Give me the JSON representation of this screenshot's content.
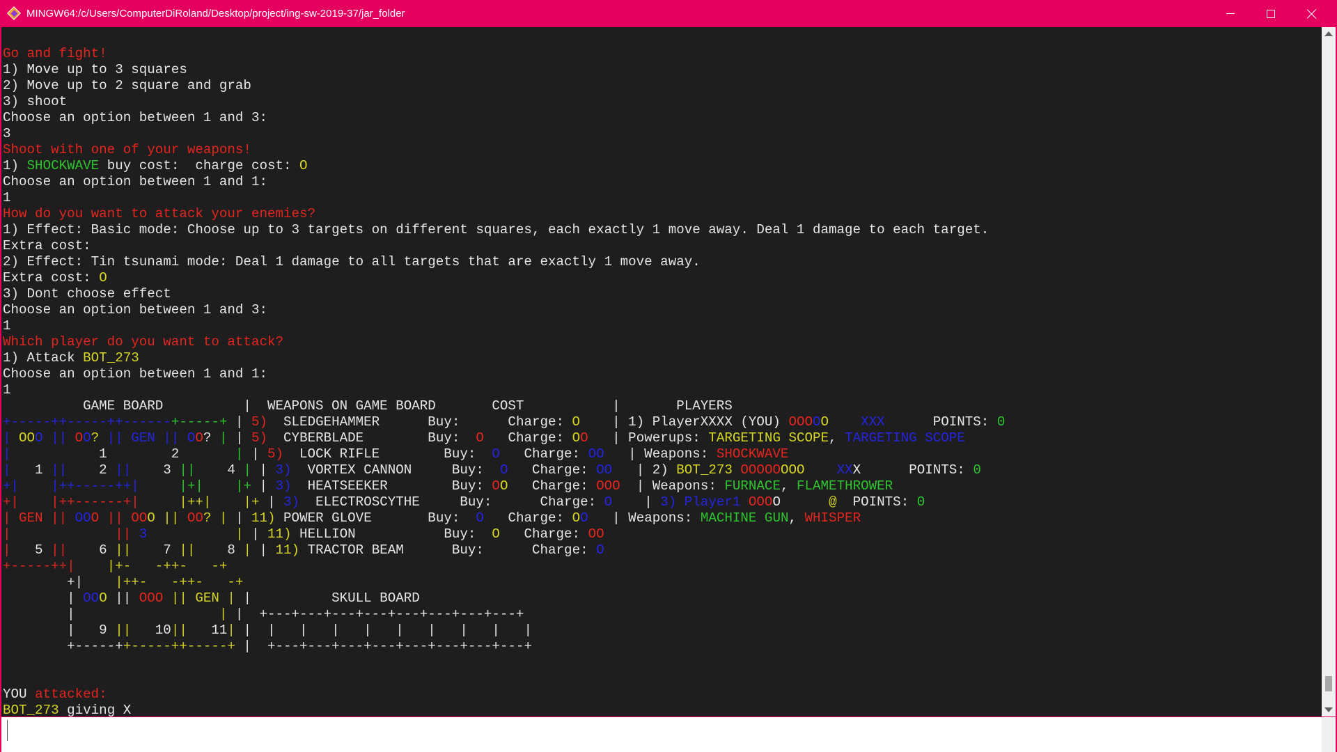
{
  "window": {
    "title": "MINGW64:/c/Users/ComputerDiRoland/Desktop/project/ing-sw-2019-37/jar_folder"
  },
  "icons": [
    "app-icon",
    "minimize-icon",
    "maximize-icon",
    "close-icon",
    "scroll-up-icon",
    "scroll-down-icon"
  ],
  "colors": {
    "titlebar": "#e5005f",
    "terminal_bg": "#1e1e1e",
    "text": "#e6e6e6",
    "red": "#e5251f",
    "green": "#2ec52e",
    "yellow": "#d6d623",
    "blue": "#2424e2"
  },
  "terminal": {
    "lines": [
      [
        {
          "t": "Go and fight!",
          "c": "r"
        }
      ],
      [
        {
          "t": "1) Move up to 3 squares"
        }
      ],
      [
        {
          "t": "2) Move up to 2 square and grab"
        }
      ],
      [
        {
          "t": "3) shoot"
        }
      ],
      [
        {
          "t": "Choose an option between 1 and 3:"
        }
      ],
      [
        {
          "t": "3"
        }
      ],
      [
        {
          "t": "Shoot with one of your weapons!",
          "c": "r"
        }
      ],
      [
        {
          "t": "1) "
        },
        {
          "t": "SHOCKWAVE",
          "c": "g"
        },
        {
          "t": " buy cost:  charge cost: "
        },
        {
          "t": "O",
          "c": "y"
        }
      ],
      [
        {
          "t": "Choose an option between 1 and 1:"
        }
      ],
      [
        {
          "t": "1"
        }
      ],
      [
        {
          "t": "How do you want to attack your enemies?",
          "c": "r"
        }
      ],
      [
        {
          "t": "1) Effect: Basic mode: Choose up to 3 targets on different squares, each exactly 1 move away. Deal 1 damage to each target."
        }
      ],
      [
        {
          "t": "Extra cost:"
        }
      ],
      [
        {
          "t": "2) Effect: Tin tsunami mode: Deal 1 damage to all targets that are exactly 1 move away."
        }
      ],
      [
        {
          "t": "Extra cost: "
        },
        {
          "t": "O",
          "c": "y"
        }
      ],
      [
        {
          "t": "3) Dont choose effect"
        }
      ],
      [
        {
          "t": "Choose an option between 1 and 3:"
        }
      ],
      [
        {
          "t": "1"
        }
      ],
      [
        {
          "t": "Which player do you want to attack?",
          "c": "r"
        }
      ],
      [
        {
          "t": "1) Attack "
        },
        {
          "t": "BOT_273",
          "c": "y"
        }
      ],
      [
        {
          "t": "Choose an option between 1 and 1:"
        }
      ],
      [
        {
          "t": "1"
        }
      ],
      [
        {
          "t": "          GAME BOARD          |  WEAPONS ON GAME BOARD       COST           |       PLAYERS"
        }
      ],
      [
        {
          "t": "+-----++-----++------",
          "c": "b"
        },
        {
          "t": "+-----+",
          "c": "g"
        },
        {
          "t": " | "
        },
        {
          "t": "5)",
          "c": "r"
        },
        {
          "t": "  SLEDGEHAMMER      Buy:      Charge: "
        },
        {
          "t": "O",
          "c": "y"
        },
        {
          "t": "    | 1) PlayerXXXX (YOU) "
        },
        {
          "t": "OOO",
          "c": "r"
        },
        {
          "t": "O",
          "c": "b"
        },
        {
          "t": "O",
          "c": "y"
        },
        {
          "t": "    "
        },
        {
          "t": "XXX",
          "c": "b"
        },
        {
          "t": "      POINTS: "
        },
        {
          "t": "0",
          "c": "g"
        }
      ],
      [
        {
          "t": "|",
          "c": "b"
        },
        {
          "t": " OO",
          "c": "y"
        },
        {
          "t": "O",
          "c": "b"
        },
        {
          "t": " || ",
          "c": "b"
        },
        {
          "t": "O",
          "c": "r"
        },
        {
          "t": "O",
          "c": "b"
        },
        {
          "t": "?",
          "c": "y"
        },
        {
          "t": " || GEN || ",
          "c": "b"
        },
        {
          "t": "O",
          "c": "b"
        },
        {
          "t": "O",
          "c": "r"
        },
        {
          "t": "?"
        },
        {
          "t": " |",
          "c": "g"
        },
        {
          "t": " | "
        },
        {
          "t": "5)",
          "c": "r"
        },
        {
          "t": "  CYBERBLADE        Buy:  "
        },
        {
          "t": "O",
          "c": "r"
        },
        {
          "t": "   Charge: "
        },
        {
          "t": "O",
          "c": "y"
        },
        {
          "t": "O",
          "c": "r"
        },
        {
          "t": "   | Powerups: "
        },
        {
          "t": "TARGETING SCOPE",
          "c": "y"
        },
        {
          "t": ", "
        },
        {
          "t": "TARGETING SCOPE",
          "c": "b"
        }
      ],
      [
        {
          "t": "|",
          "c": "b"
        },
        {
          "t": "           1        2       "
        },
        {
          "t": "|",
          "c": "g"
        },
        {
          "t": " | "
        },
        {
          "t": "5)",
          "c": "r"
        },
        {
          "t": "  LOCK RIFLE        Buy:  "
        },
        {
          "t": "O",
          "c": "b"
        },
        {
          "t": "   Charge: "
        },
        {
          "t": "OO",
          "c": "b"
        },
        {
          "t": "   | Weapons: "
        },
        {
          "t": "SHOCKWAVE",
          "c": "r"
        }
      ],
      [
        {
          "t": "|",
          "c": "b"
        },
        {
          "t": "   1 "
        },
        {
          "t": "||",
          "c": "b"
        },
        {
          "t": "    2 "
        },
        {
          "t": "||",
          "c": "b"
        },
        {
          "t": "    3 "
        },
        {
          "t": "||",
          "c": "g"
        },
        {
          "t": "    4 "
        },
        {
          "t": "|",
          "c": "g"
        },
        {
          "t": " | "
        },
        {
          "t": "3)",
          "c": "b"
        },
        {
          "t": "  VORTEX CANNON     Buy:  "
        },
        {
          "t": "O",
          "c": "b"
        },
        {
          "t": "   Charge: "
        },
        {
          "t": "OO",
          "c": "b"
        },
        {
          "t": "   | 2) "
        },
        {
          "t": "BOT_273",
          "c": "y"
        },
        {
          "t": " "
        },
        {
          "t": "OOOOO",
          "c": "r"
        },
        {
          "t": "OOO",
          "c": "y"
        },
        {
          "t": "    "
        },
        {
          "t": "XX",
          "c": "b"
        },
        {
          "t": "X      POINTS: "
        },
        {
          "t": "0",
          "c": "g"
        }
      ],
      [
        {
          "t": "+|",
          "c": "b"
        },
        {
          "t": "    "
        },
        {
          "t": "|++-----++|",
          "c": "b"
        },
        {
          "t": "     "
        },
        {
          "t": "|+|",
          "c": "g"
        },
        {
          "t": "    "
        },
        {
          "t": "|+",
          "c": "g"
        },
        {
          "t": " | "
        },
        {
          "t": "3)",
          "c": "b"
        },
        {
          "t": "  HEATSEEKER        Buy: "
        },
        {
          "t": "O",
          "c": "r"
        },
        {
          "t": "O",
          "c": "y"
        },
        {
          "t": "   Charge: "
        },
        {
          "t": "OOO",
          "c": "r"
        },
        {
          "t": "  | Weapons: "
        },
        {
          "t": "FURNACE",
          "c": "g"
        },
        {
          "t": ", "
        },
        {
          "t": "FLAMETHROWER",
          "c": "g"
        }
      ],
      [
        {
          "t": "+|",
          "c": "r"
        },
        {
          "t": "    "
        },
        {
          "t": "|++------+|",
          "c": "r"
        },
        {
          "t": "     "
        },
        {
          "t": "|++|",
          "c": "y"
        },
        {
          "t": "    "
        },
        {
          "t": "|+",
          "c": "y"
        },
        {
          "t": " | "
        },
        {
          "t": "3)",
          "c": "b"
        },
        {
          "t": "  ELECTROSCYTHE     Buy:      Charge: "
        },
        {
          "t": "O",
          "c": "b"
        },
        {
          "t": "    | "
        },
        {
          "t": "3) Player1",
          "c": "b"
        },
        {
          "t": " "
        },
        {
          "t": "OOO",
          "c": "r"
        },
        {
          "t": "O      "
        },
        {
          "t": "@",
          "c": "y"
        },
        {
          "t": "  POINTS: "
        },
        {
          "t": "0",
          "c": "g"
        }
      ],
      [
        {
          "t": "| ",
          "c": "r"
        },
        {
          "t": "GEN",
          "c": "r"
        },
        {
          "t": " || ",
          "c": "r"
        },
        {
          "t": "OO",
          "c": "b"
        },
        {
          "t": "O",
          "c": "r"
        },
        {
          "t": " || ",
          "c": "r"
        },
        {
          "t": "OO",
          "c": "r"
        },
        {
          "t": "O",
          "c": "y"
        },
        {
          "t": " || ",
          "c": "y"
        },
        {
          "t": "OO",
          "c": "r"
        },
        {
          "t": "?",
          "c": "y"
        },
        {
          "t": " |",
          "c": "y"
        },
        {
          "t": " | "
        },
        {
          "t": "11)",
          "c": "y"
        },
        {
          "t": " POWER GLOVE       Buy:  "
        },
        {
          "t": "O",
          "c": "b"
        },
        {
          "t": "   Charge: "
        },
        {
          "t": "O",
          "c": "y"
        },
        {
          "t": "O",
          "c": "b"
        },
        {
          "t": "   | Weapons: "
        },
        {
          "t": "MACHINE GUN",
          "c": "g"
        },
        {
          "t": ", "
        },
        {
          "t": "WHISPER",
          "c": "r"
        }
      ],
      [
        {
          "t": "|",
          "c": "r"
        },
        {
          "t": "             "
        },
        {
          "t": "||",
          "c": "r"
        },
        {
          "t": " "
        },
        {
          "t": "3",
          "c": "b"
        },
        {
          "t": "           "
        },
        {
          "t": "|",
          "c": "y"
        },
        {
          "t": " | "
        },
        {
          "t": "11)",
          "c": "y"
        },
        {
          "t": " HELLION           Buy:  "
        },
        {
          "t": "O",
          "c": "y"
        },
        {
          "t": "   Charge: "
        },
        {
          "t": "OO",
          "c": "r"
        }
      ],
      [
        {
          "t": "|",
          "c": "r"
        },
        {
          "t": "   5 "
        },
        {
          "t": "||",
          "c": "r"
        },
        {
          "t": "    6 "
        },
        {
          "t": "||",
          "c": "y"
        },
        {
          "t": "    7 "
        },
        {
          "t": "||",
          "c": "y"
        },
        {
          "t": "    8 "
        },
        {
          "t": "|",
          "c": "y"
        },
        {
          "t": " | "
        },
        {
          "t": "11)",
          "c": "y"
        },
        {
          "t": " TRACTOR BEAM      Buy:      Charge: "
        },
        {
          "t": "O",
          "c": "b"
        }
      ],
      [
        {
          "t": "+-----++|",
          "c": "r"
        },
        {
          "t": "    "
        },
        {
          "t": "|+-   -++-   -+",
          "c": "y"
        }
      ],
      [
        {
          "t": "        +|"
        },
        {
          "t": "    "
        },
        {
          "t": "|++-   -++-   -+",
          "c": "y"
        }
      ],
      [
        {
          "t": "        | "
        },
        {
          "t": "OO",
          "c": "b"
        },
        {
          "t": "O",
          "c": "y"
        },
        {
          "t": " || "
        },
        {
          "t": "OOO",
          "c": "r"
        },
        {
          "t": " || ",
          "c": "y"
        },
        {
          "t": "GEN",
          "c": "y"
        },
        {
          "t": " |",
          "c": "y"
        },
        {
          "t": " |          SKULL BOARD"
        }
      ],
      [
        {
          "t": "        |                  "
        },
        {
          "t": "|",
          "c": "y"
        },
        {
          "t": " |  +---+---+---+---+---+---+---+---+"
        }
      ],
      [
        {
          "t": "        |   9 "
        },
        {
          "t": "||",
          "c": "y"
        },
        {
          "t": "   10"
        },
        {
          "t": "||",
          "c": "y"
        },
        {
          "t": "   11"
        },
        {
          "t": "|",
          "c": "y"
        },
        {
          "t": " |  |   |   |   |   |   |   |   |   |"
        }
      ],
      [
        {
          "t": "        +-----+"
        },
        {
          "t": "+-----++-----+",
          "c": "y"
        },
        {
          "t": " |  +---+---+---+---+---+---+---+---+"
        }
      ],
      [
        {
          "t": ""
        }
      ],
      [
        {
          "t": ""
        }
      ],
      [
        {
          "t": "YOU "
        },
        {
          "t": "attacked:",
          "c": "r"
        }
      ],
      [
        {
          "t": "BOT_273",
          "c": "y"
        },
        {
          "t": " giving X"
        }
      ]
    ]
  }
}
